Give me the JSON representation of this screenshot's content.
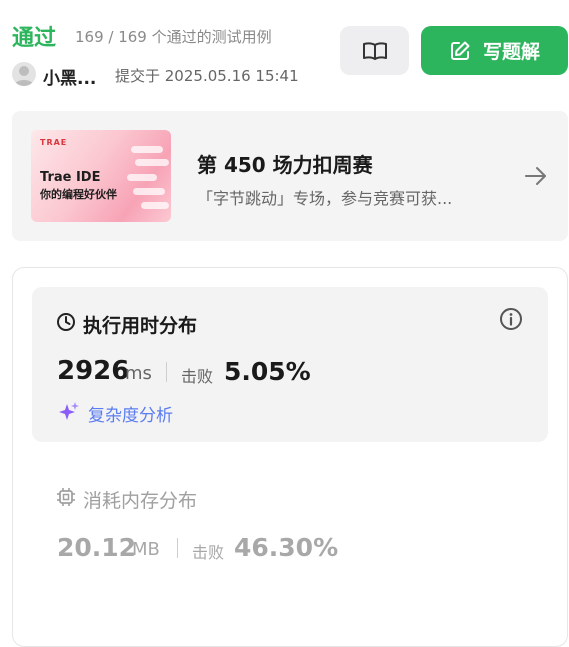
{
  "header": {
    "status": "通过",
    "cases": "169 / 169 个通过的测试用例",
    "user_name": "小黑...",
    "submitted": "提交于 2025.05.16 15:41",
    "solution_button": "写题解"
  },
  "banner": {
    "thumb_brand": "TRAE",
    "thumb_line1": "Trae IDE",
    "thumb_line2": "你的编程好伙伴",
    "title": "第 450 场力扣周赛",
    "subtitle": "「字节跳动」专场，参与竞赛可获..."
  },
  "runtime": {
    "title": "执行用时分布",
    "value": "2926",
    "unit": "ms",
    "beat_label": "击败",
    "beat_value": "5.05%",
    "complexity_link": "复杂度分析"
  },
  "memory": {
    "title": "消耗内存分布",
    "value": "20.12",
    "unit": "MB",
    "beat_label": "击败",
    "beat_value": "46.30%"
  },
  "colors": {
    "accent_green": "#2db55d",
    "link_blue": "#5b7cf0",
    "sparkle_purple": "#8b5cf6"
  },
  "icons": [
    "book-open-icon",
    "edit-icon",
    "arrow-right-icon",
    "clock-icon",
    "info-icon",
    "sparkle-icon",
    "chip-icon",
    "avatar-icon"
  ]
}
